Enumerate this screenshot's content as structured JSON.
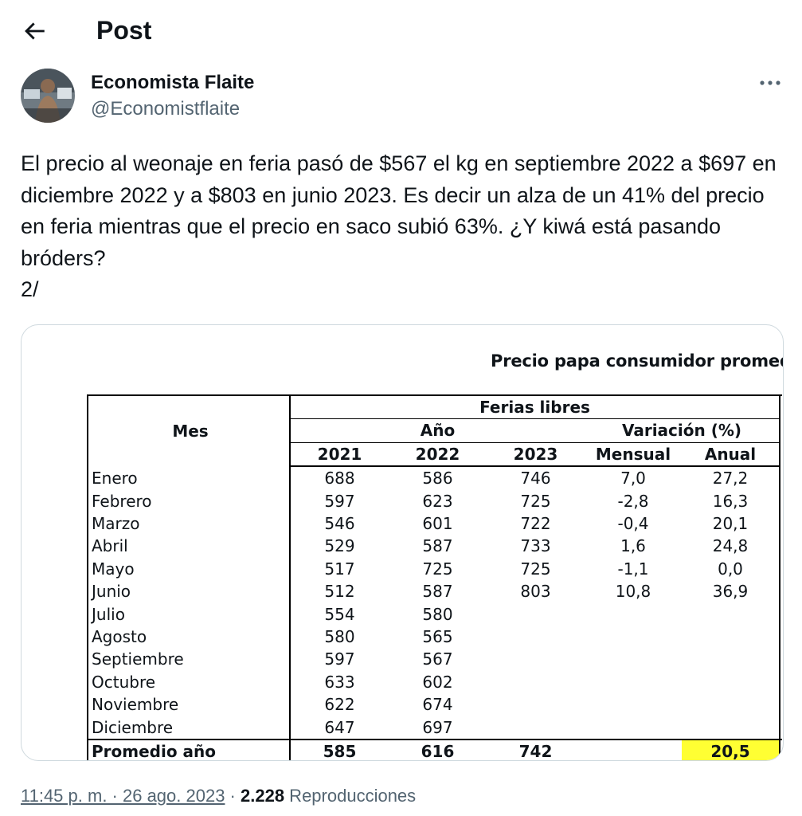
{
  "header": {
    "title": "Post",
    "back_icon": "arrow-left-icon"
  },
  "author": {
    "name": "Economista Flaite",
    "handle": "@Economistflaite"
  },
  "tweet": {
    "text": "El precio al weonaje en feria pasó de $567 el kg en septiembre 2022 a $697 en diciembre 2022 y a $803 en junio 2023. Es decir un alza de un 41% del precio en feria mientras que el precio en saco subió 63%. ¿Y kiwá está pasando bróders?\n2/"
  },
  "image": {
    "title": "Precio papa consumidor promedio m",
    "header": {
      "mes": "Mes",
      "ferias": "Ferias libres",
      "anio": "Año",
      "variacion": "Variación (%)",
      "y2021": "2021",
      "y2022": "2022",
      "y2023": "2023",
      "mensual": "Mensual",
      "anual": "Anual"
    },
    "rows": [
      [
        "Enero",
        "688",
        "586",
        "746",
        "7,0",
        "27,2"
      ],
      [
        "Febrero",
        "597",
        "623",
        "725",
        "-2,8",
        "16,3"
      ],
      [
        "Marzo",
        "546",
        "601",
        "722",
        "-0,4",
        "20,1"
      ],
      [
        "Abril",
        "529",
        "587",
        "733",
        "1,6",
        "24,8"
      ],
      [
        "Mayo",
        "517",
        "725",
        "725",
        "-1,1",
        "0,0"
      ],
      [
        "Junio",
        "512",
        "587",
        "803",
        "10,8",
        "36,9"
      ],
      [
        "Julio",
        "554",
        "580",
        "",
        "",
        ""
      ],
      [
        "Agosto",
        "580",
        "565",
        "",
        "",
        ""
      ],
      [
        "Septiembre",
        "597",
        "567",
        "",
        "",
        ""
      ],
      [
        "Octubre",
        "633",
        "602",
        "",
        "",
        ""
      ],
      [
        "Noviembre",
        "622",
        "674",
        "",
        "",
        ""
      ],
      [
        "Diciembre",
        "647",
        "697",
        "",
        "",
        ""
      ]
    ],
    "total": [
      "Promedio año",
      "585",
      "616",
      "742",
      "",
      "20,5"
    ],
    "highlight_color": "#ffff33"
  },
  "meta": {
    "time": "11:45 p. m. · 26 ago. 2023",
    "sep": " · ",
    "views_count": "2.228",
    "views_label": " Reproducciones"
  },
  "colors": {
    "text": "#0f1419",
    "secondary": "#536471",
    "border": "#cfd9de"
  }
}
